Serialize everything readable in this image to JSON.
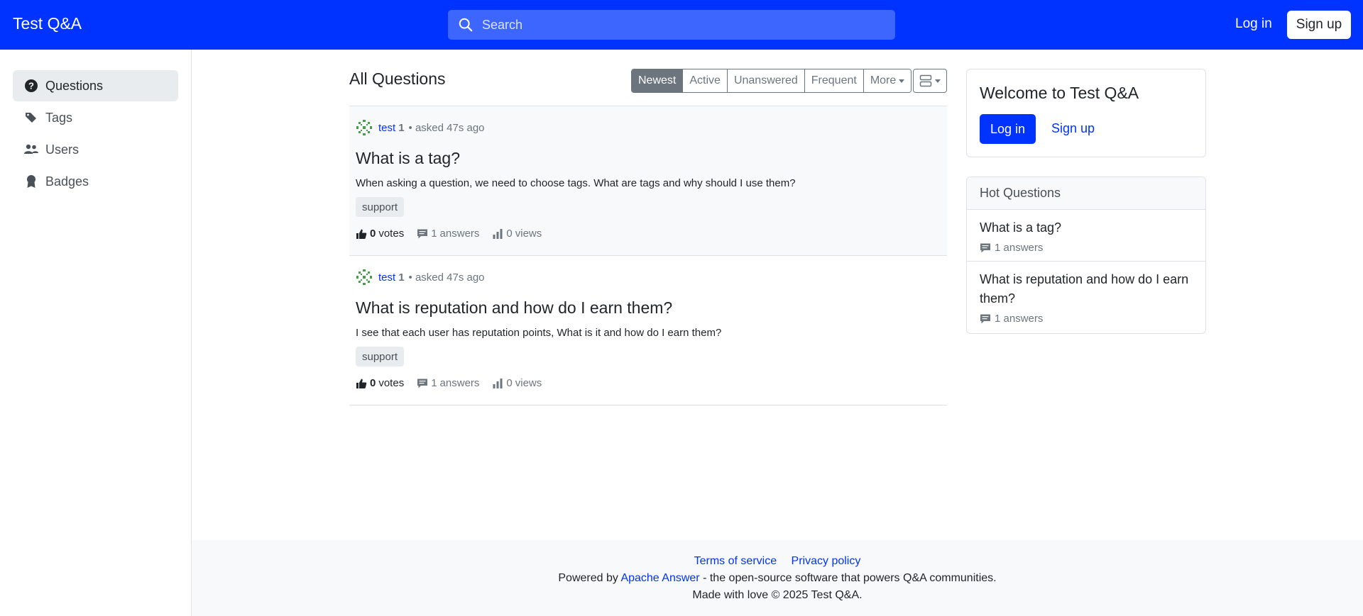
{
  "header": {
    "brand": "Test Q&A",
    "search_placeholder": "Search",
    "login_label": "Log in",
    "signup_label": "Sign up"
  },
  "sidebar": {
    "items": [
      {
        "label": "Questions",
        "icon": "question-circle-icon",
        "active": true
      },
      {
        "label": "Tags",
        "icon": "tags-icon"
      },
      {
        "label": "Users",
        "icon": "people-icon"
      },
      {
        "label": "Badges",
        "icon": "award-icon"
      }
    ]
  },
  "main": {
    "title": "All Questions",
    "sort_tabs": [
      "Newest",
      "Active",
      "Unanswered",
      "Frequent",
      "More"
    ],
    "active_sort": "Newest",
    "questions": [
      {
        "author": "test",
        "reputation": "1",
        "asked": "• asked 47s ago",
        "title": "What is a tag?",
        "excerpt": "When asking a question, we need to choose tags. What are tags and why should I use them?",
        "tag": "support",
        "votes": "0",
        "votes_label": "votes",
        "answers": "1",
        "answers_label": "answers",
        "views": "0",
        "views_label": "views"
      },
      {
        "author": "test",
        "reputation": "1",
        "asked": "• asked 47s ago",
        "title": "What is reputation and how do I earn them?",
        "excerpt": "I see that each user has reputation points, What is it and how do I earn them?",
        "tag": "support",
        "votes": "0",
        "votes_label": "votes",
        "answers": "1",
        "answers_label": "answers",
        "views": "0",
        "views_label": "views"
      }
    ]
  },
  "welcome": {
    "title": "Welcome to Test Q&A",
    "login_label": "Log in",
    "signup_label": "Sign up"
  },
  "hot": {
    "heading": "Hot Questions",
    "items": [
      {
        "title": "What is a tag?",
        "answers": "1 answers"
      },
      {
        "title": "What is reputation and how do I earn them?",
        "answers": "1 answers"
      }
    ]
  },
  "footer": {
    "terms": "Terms of service",
    "privacy": "Privacy policy",
    "powered_prefix": "Powered by",
    "powered_link": "Apache Answer",
    "powered_suffix": "- the open-source software that powers Q&A communities.",
    "made": "Made with love © 2025 Test Q&A."
  },
  "colors": {
    "brand": "#0033ff",
    "muted": "#6c757d"
  }
}
